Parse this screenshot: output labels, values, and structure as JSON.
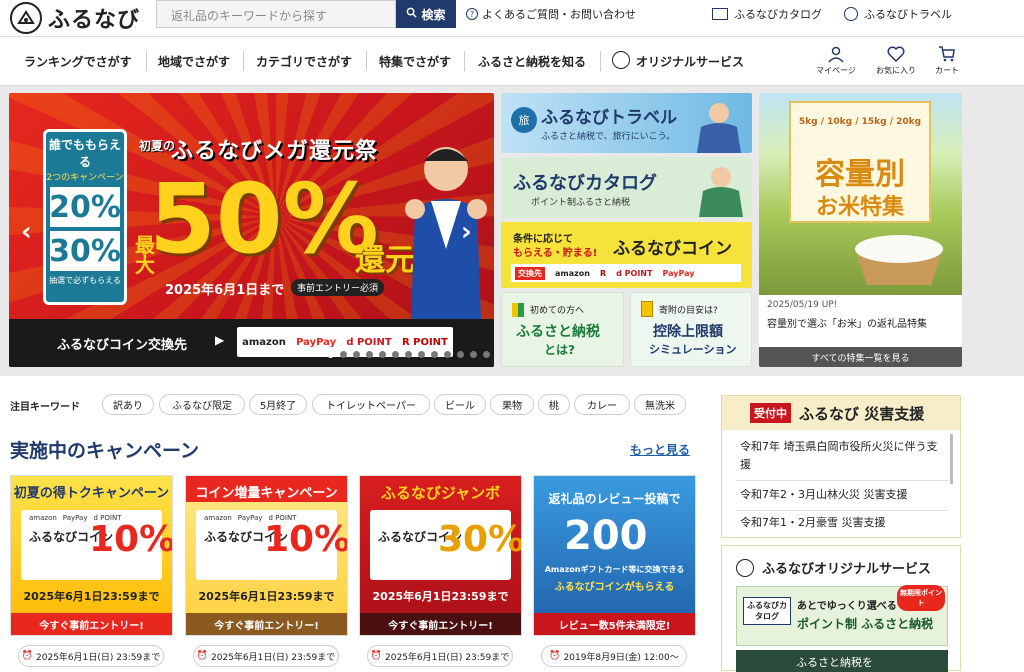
{
  "header": {
    "logo_text": "ふるなび",
    "search_placeholder": "返礼品のキーワードから探す",
    "search_button": "検索",
    "faq": "よくあるご質問・お問い合わせ",
    "catalog_link": "ふるなびカタログ",
    "travel_link": "ふるなびトラベル"
  },
  "nav": {
    "items": [
      "ランキングでさがす",
      "地域でさがす",
      "カテゴリでさがす",
      "特集でさがす",
      "ふるさと納税を知る",
      "オリジナルサービス"
    ],
    "icons": [
      "マイページ",
      "お気に入り",
      "カート"
    ]
  },
  "hero": {
    "badge_l1": "誰でももらえる",
    "badge_l2": "2つのキャンペーン",
    "pct1": "20%",
    "pct2": "30%",
    "badge_l3": "抽選で必ずもらえる",
    "sub": "初夏の",
    "title": "ふるなびメガ還元祭",
    "max": "最大",
    "big": "50%",
    "big2": "還元",
    "date": "2025年6月1日まで",
    "entry": "事前エントリー必須",
    "bar_label": "ふるなびコイン交換先",
    "logos": [
      "amazon",
      "PayPay",
      "d POINT",
      "R POINT"
    ]
  },
  "side_banners": {
    "travel_title": "ふるなびトラベル",
    "travel_sub": "ふるさと納税で、旅行にいこう。",
    "catalog_title": "ふるなびカタログ",
    "catalog_sub": "ポイント制ふるさと納税",
    "coin_lead": "条件に応じて",
    "coin_lead2": "もらえる・貯まる!",
    "coin_title": "ふるなびコイン",
    "coin_exchange": "交換先",
    "coin_logos": [
      "amazon",
      "R",
      "d POINT",
      "PayPay"
    ],
    "beg_small": "初めての方へ",
    "beg_title": "ふるさと納税",
    "beg_q": "とは?",
    "sim_small": "寄附の目安は?",
    "sim_title": "控除上限額",
    "sim_sub": "シミュレーション"
  },
  "rice": {
    "kg": "5kg / 10kg / 15kg / 20kg",
    "title1": "容量別",
    "title2": "お米特集",
    "date": "2025/05/19 UP!",
    "desc": "容量別で選ぶ「お米」の返礼品特集",
    "all": "すべての特集一覧を見る"
  },
  "keywords": {
    "label": "注目キーワード",
    "items": [
      "訳あり",
      "ふるなび限定",
      "5月終了",
      "トイレットペーパー",
      "ビール",
      "果物",
      "桃",
      "カレー",
      "無洗米"
    ]
  },
  "campaign": {
    "title": "実施中のキャンペーン",
    "more": "もっと見る",
    "cards": [
      {
        "head": "初夏の得トクキャンペーン",
        "coin": "ふるなびコイン",
        "pct": "10%",
        "date": "2025年6月1日23:59まで",
        "bottom": "今すぐ事前エントリー!",
        "deadline": "2025年6月1日(日) 23:59まで"
      },
      {
        "head": "コイン増量キャンペーン",
        "coin": "ふるなびコイン",
        "pct": "10%",
        "date": "2025年6月1日23:59まで",
        "bottom": "今すぐ事前エントリー!",
        "deadline": "2025年6月1日(日) 23:59まで"
      },
      {
        "head": "ふるなびジャンボ",
        "coin": "ふるなびコイン",
        "pct": "30%",
        "date": "2025年6月1日23:59まで",
        "bottom": "今すぐ事前エントリー!",
        "deadline": "2025年6月1日(日) 23:59まで"
      },
      {
        "head": "返礼品のレビュー投稿で",
        "coin": "ふるなびコインがもらえる",
        "pct": "200",
        "date": "Amazonギフトカード等に交換できる",
        "bottom": "レビュー数5件未満限定!",
        "deadline": "2019年8月9日(金) 12:00〜"
      }
    ]
  },
  "disaster": {
    "badge": "受付中",
    "title": "ふるなび 災害支援",
    "items": [
      "令和7年 埼玉県白岡市役所火災に伴う支援",
      "令和7年2・3月山林火災 災害支援",
      "令和7年1・2月豪雪 災害支援"
    ]
  },
  "original": {
    "title": "ふるなびオリジナルサービス",
    "catalog_tag": "ふるなびカタログ",
    "l1": "あとでゆっくり選べる",
    "l2": "ポイント制 ふるさと納税",
    "free": "無期限ポイント",
    "premium": "ふるさと納税を"
  }
}
